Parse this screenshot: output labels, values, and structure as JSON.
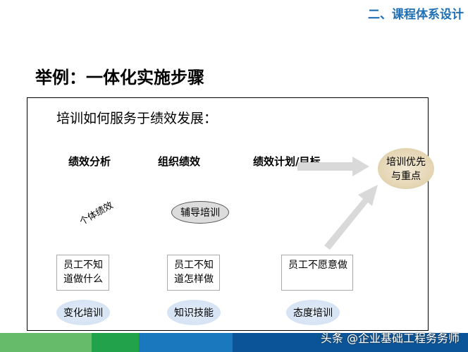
{
  "header": {
    "section": "二、课程体系设计",
    "title": "举例：一体化实施步骤"
  },
  "diagram": {
    "subtitle": "培训如何服务于绩效发展：",
    "levels": [
      "绩效分析",
      "组织绩效",
      "绩效计划/目标"
    ],
    "individual": "个体绩效",
    "coaching": "辅导培训",
    "goal": [
      "培训优先",
      "与重点"
    ],
    "problems": [
      "员工不知道做什么",
      "员工不知道怎样做",
      "员工不愿意做"
    ],
    "trainings": [
      "变化培训",
      "知识技能",
      "态度培训"
    ]
  },
  "footer": {
    "watermark": "头条 @企业基础工程务务师",
    "colors": [
      "#66bb6a",
      "#22a24a",
      "#1a78bf",
      "#0b5497"
    ]
  }
}
